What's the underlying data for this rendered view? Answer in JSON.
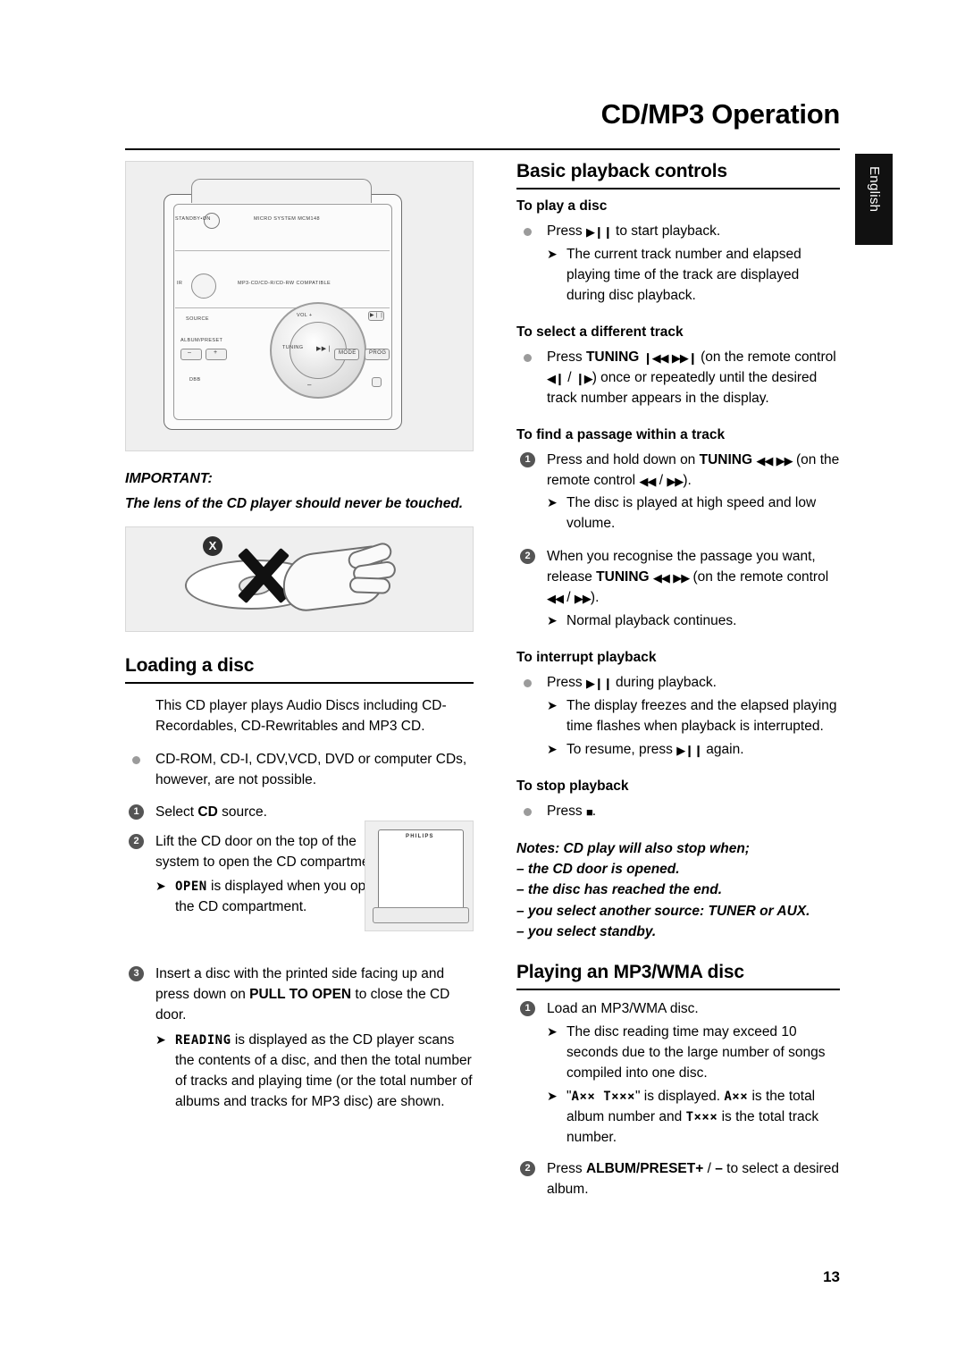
{
  "header": {
    "title": "CD/MP3 Operation",
    "side_tab": "English"
  },
  "page_number": "13",
  "left_column": {
    "device_illustration": {
      "standby_label": "STANDBY•ON",
      "model_label": "MICRO SYSTEM MCM148",
      "ir_label": "IR",
      "compat_label": "MP3-CD/CD-R/CD-RW COMPATIBLE",
      "source_label": "SOURCE",
      "album_preset_label": "ALBUM/PRESET",
      "minus_label": "–",
      "plus_label": "+",
      "dbb_label": "DBB",
      "vol_label": "VOL +",
      "tuning_label": "TUNING",
      "mode_label": "MODE",
      "prog_label": "PROG"
    },
    "important_heading": "IMPORTANT:",
    "important_text": "The lens of the CD player should never be touched.",
    "lens_illustration": {
      "x_badge": "X"
    },
    "loading": {
      "heading": "Loading a disc",
      "intro": "This CD player plays Audio Discs including CD-Recordables, CD-Rewritables and MP3 CD.",
      "bullet": "CD-ROM, CD-I, CDV,VCD, DVD or computer CDs, however, are not possible.",
      "step1_pre": "Select ",
      "step1_bold": "CD",
      "step1_post": " source.",
      "step2": "Lift the CD door on the top of the system to open the CD compartment.",
      "step2_sub_pre": "",
      "step2_sub_dot": "OPEN",
      "step2_sub_post": " is displayed when you open the CD compartment.",
      "step3_pre": "Insert a disc with the printed side facing up and press down on ",
      "step3_bold": "PULL TO OPEN",
      "step3_post": " to close the CD door.",
      "step3_sub_dot": "READING",
      "step3_sub_post": " is displayed as the CD player scans the contents of a disc, and then the total number of tracks and playing time (or the total number of albums and tracks for MP3 disc) are shown."
    },
    "door_illustration": {
      "brand": "PHILIPS"
    }
  },
  "right_column": {
    "basic": {
      "heading": "Basic playback controls",
      "play": {
        "sub_heading": "To play a disc",
        "bullet_pre": "Press ",
        "bullet_glyph": "▶❙❙",
        "bullet_post": " to start playback.",
        "arrow": "The current track number and elapsed playing time of the track are displayed during disc playback."
      },
      "select_track": {
        "sub_heading": "To select a different track",
        "bullet_pre": "Press ",
        "bullet_bold": "TUNING",
        "glyph_prev": "❙◀◀",
        "glyph_next": "▶▶❙",
        "bullet_mid": "(on the remote control ",
        "glyph_prev2": "◀❙",
        "slash": " / ",
        "glyph_next2": "❙▶",
        "bullet_post": ") once or repeatedly until the desired track number appears in the display."
      },
      "find_passage": {
        "sub_heading": "To find a passage within a track",
        "step1_pre": "Press and hold down on ",
        "step1_bold": "TUNING",
        "step1_glyph_prev": "◀◀",
        "step1_glyph_next": "▶▶",
        "step1_post": "(on the remote control ",
        "step1_glyph_prev2": "◀◀",
        "step1_glyph_next2": "▶▶",
        "step1_end": ").",
        "step1_arrow": "The disc is played at high speed and low volume.",
        "step2_pre": "When you recognise the passage you want, release ",
        "step2_bold": "TUNING",
        "step2_post": "(on the remote control ",
        "step2_end": ").",
        "step2_arrow": "Normal playback continues."
      },
      "interrupt": {
        "sub_heading": "To interrupt playback",
        "bullet_pre": "Press ",
        "bullet_post": " during playback.",
        "arrow1": "The display freezes and the elapsed playing time flashes when playback is interrupted.",
        "arrow2_pre": "To resume, press ",
        "arrow2_post": " again."
      },
      "stop": {
        "sub_heading": "To stop playback",
        "bullet_pre": "Press ",
        "bullet_glyph": "■",
        "bullet_post": ".",
        "notes_title": "Notes: CD play will also stop when;",
        "note1": "– the CD door is opened.",
        "note2": "– the disc has reached the end.",
        "note3": "– you select another source: TUNER or AUX.",
        "note4": "– you select standby."
      }
    },
    "mp3": {
      "heading": "Playing an MP3/WMA disc",
      "step1": "Load an MP3/WMA disc.",
      "step1_arrow1": "The disc reading time may exceed 10 seconds due to the large number of songs compiled into one disc.",
      "step1_arrow2_pre": "\"",
      "step1_arrow2_dot1": "A××  T×××",
      "step1_arrow2_mid": "\" is displayed. ",
      "step1_arrow2_dot2": "A××",
      "step1_arrow2_mid2": " is the total album number and ",
      "step1_arrow2_dot3": "T×××",
      "step1_arrow2_post": " is the total track number.",
      "step2_pre": "Press ",
      "step2_bold": "ALBUM/PRESET",
      "step2_plus": "+",
      "step2_slash": " / ",
      "step2_minus": "–",
      "step2_post": " to select a desired album."
    }
  }
}
